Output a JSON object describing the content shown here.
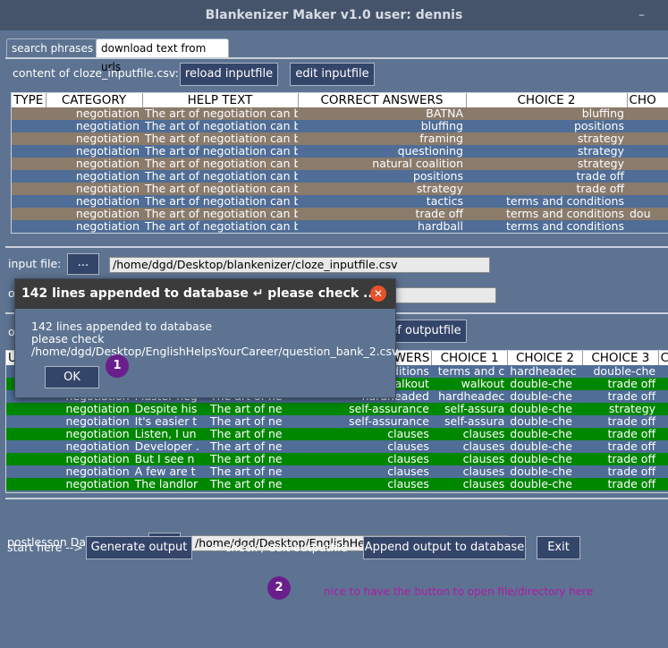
{
  "window": {
    "title": "Blankenizer Maker v1.0 user: dennis",
    "minimize": "–"
  },
  "tabs": [
    {
      "label": "search phrases"
    },
    {
      "label": "download text from urls"
    }
  ],
  "top": {
    "content_label": "content of cloze_inputfile.csv:",
    "reload_label": "reload inputfile",
    "edit_label": "edit inputfile",
    "headers": [
      "TYPE",
      "CATEGORY",
      "HELP TEXT",
      "CORRECT ANSWERS",
      "CHOICE 2",
      "CHO"
    ],
    "rows": [
      [
        "",
        "negotiation",
        "The art of negotiation can be r",
        "BATNA",
        "bluffing",
        ""
      ],
      [
        "",
        "negotiation",
        "The art of negotiation can be r",
        "bluffing",
        "positions",
        ""
      ],
      [
        "",
        "negotiation",
        "The art of negotiation can be r",
        "framing",
        "strategy",
        ""
      ],
      [
        "",
        "negotiation",
        "The art of negotiation can be r",
        "questioning",
        "strategy",
        ""
      ],
      [
        "",
        "negotiation",
        "The art of negotiation can be r",
        "natural coalition",
        "strategy",
        ""
      ],
      [
        "",
        "negotiation",
        "The art of negotiation can be r",
        "positions",
        "trade off",
        ""
      ],
      [
        "",
        "negotiation",
        "The art of negotiation can be r",
        "strategy",
        "trade off",
        ""
      ],
      [
        "",
        "negotiation",
        "The art of negotiation can be r",
        "tactics",
        "terms and conditions",
        ""
      ],
      [
        "",
        "negotiation",
        "The art of negotiation can be r",
        "trade off",
        "terms and conditions",
        "dou"
      ],
      [
        "",
        "negotiation",
        "The art of negotiation can be r",
        "hardball",
        "terms and conditions",
        ""
      ]
    ]
  },
  "input_file": {
    "label": "input file:",
    "browse": "...",
    "value": "/home/dgd/Desktop/blankenizer/cloze_inputfile.csv"
  },
  "output_file": {
    "label": "ou",
    "value": ""
  },
  "mid": {
    "ou_label": "ou",
    "edit_outputfile": "of outputfile"
  },
  "bottom": {
    "headers": [
      "U",
      "",
      "",
      "",
      "WERS",
      "CHOICE 1",
      "CHOICE 2",
      "CHOICE 3",
      "CHOIC"
    ],
    "rows": [
      [
        "",
        "",
        "",
        "",
        "nditions",
        "terms and c",
        "hardheadec",
        "double-che",
        ""
      ],
      [
        "",
        "",
        "",
        "",
        "walkout",
        "walkout",
        "double-che",
        "trade off",
        "hardhea"
      ],
      [
        "",
        "negotiation",
        "Master neg",
        "The art of ne",
        "hardheaded",
        "hardheadec",
        "double-che",
        "trade off",
        "hardhea"
      ],
      [
        "",
        "negotiation",
        "Despite his",
        "The art of ne",
        "self-assurance",
        "self-assura",
        "double-che",
        "strategy",
        "trade"
      ],
      [
        "",
        "negotiation",
        "It's easier t",
        "The art of ne",
        "self-assurance",
        "self-assura",
        "double-che",
        "trade off",
        "trade"
      ],
      [
        "",
        "negotiation",
        "Listen, I un",
        "The art of ne",
        "clauses",
        "clauses",
        "double-che",
        "trade off",
        "hardhea"
      ],
      [
        "",
        "negotiation",
        "Developer .",
        "The art of ne",
        "clauses",
        "clauses",
        "double-che",
        "trade off",
        "hardhea"
      ],
      [
        "",
        "negotiation",
        "But I see n",
        "The art of ne",
        "clauses",
        "clauses",
        "double-che",
        "trade off",
        "hardhea"
      ],
      [
        "",
        "negotiation",
        "A few are t",
        "The art of ne",
        "clauses",
        "clauses",
        "double-che",
        "trade off",
        "hardhea"
      ],
      [
        "",
        "negotiation",
        "The landlor",
        "The art of ne",
        "clauses",
        "clauses",
        "double-che",
        "trade off",
        "hardhea"
      ]
    ]
  },
  "postlesson": {
    "label": "postlesson Databasefile:",
    "browse": "...",
    "value": "/home/dgd/Desktop/EnglishHelpsYourCareer/question_bank_"
  },
  "actions": {
    "start_label": "start here -->",
    "generate": "Generate output",
    "check_label": "--> check / edit outputfile -->",
    "append": "Append output to database",
    "exit": "Exit"
  },
  "dialog": {
    "title": "142 lines appended to database ↵ please check ...",
    "min": "–",
    "close": "✕",
    "line1": "142 lines appended to database",
    "line2": "please check",
    "line3": "/home/dgd/Desktop/EnglishHelpsYourCareer/question_bank_2.csv",
    "ok": "OK"
  },
  "annotations": {
    "badge1": "1",
    "badge2": "2",
    "note": "nice to have the button to open file/directory here",
    "badge_color": "#6a1e8c",
    "note_color": "#b21aa8"
  }
}
